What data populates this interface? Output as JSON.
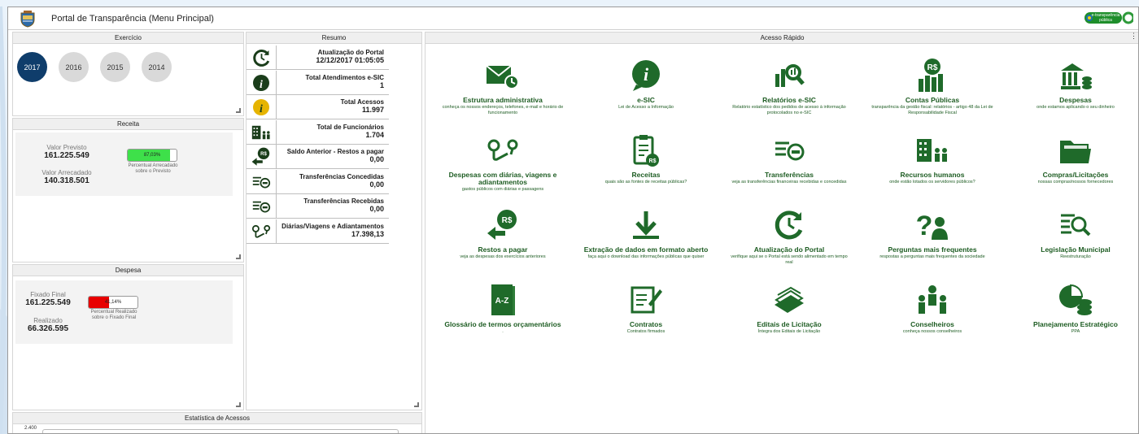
{
  "app": {
    "title": "Portal de Transparência (Menu Principal)",
    "badge_text": "e-transparência pública"
  },
  "exercicio": {
    "title": "Exercício",
    "years": [
      "2017",
      "2016",
      "2015",
      "2014"
    ],
    "selected": "2017"
  },
  "receita": {
    "title": "Receita",
    "previsto_label": "Valor Previsto",
    "previsto": "161.225.549",
    "arrecadado_label": "Valor Arrecadado",
    "arrecadado": "140.318.501",
    "percent_text": "87,03%",
    "percent_value": 87.03,
    "caption": "Percentual Arrecadado sobre o Previsto",
    "bar_color": "#3ee04a"
  },
  "despesa": {
    "title": "Despesa",
    "fixado_label": "Fixado Final",
    "fixado": "161.225.549",
    "realizado_label": "Realizado",
    "realizado": "66.326.595",
    "percent_text": "41,14%",
    "percent_value": 41.14,
    "caption": "Percentual Realizado sobre o Fixado Final",
    "bar_color": "#e80000"
  },
  "estatistica": {
    "title": "Estatística de Acessos",
    "y_tick": "2.400"
  },
  "resumo": {
    "title": "Resumo",
    "rows": [
      {
        "label": "Atualização do Portal",
        "value": "12/12/2017 01:05:05",
        "icon": "refresh-clock-icon"
      },
      {
        "label": "Total Atendimentos e-SIC",
        "value": "1",
        "icon": "info-icon"
      },
      {
        "label": "Total Acessos",
        "value": "11.997",
        "icon": "info-yellow-icon"
      },
      {
        "label": "Total de Funcionários",
        "value": "1.704",
        "icon": "building-people-icon"
      },
      {
        "label": "Saldo Anterior - Restos a pagar",
        "value": "0,00",
        "icon": "money-arrow-icon"
      },
      {
        "label": "Transferências Concedidas",
        "value": "0,00",
        "icon": "transfer-icon"
      },
      {
        "label": "Transferências Recebidas",
        "value": "0,00",
        "icon": "transfer-icon"
      },
      {
        "label": "Diárias/Viagens e Adiantamentos",
        "value": "17.398,13",
        "icon": "route-icon"
      }
    ]
  },
  "acesso": {
    "title": "Acesso Rápido",
    "tiles": [
      {
        "title": "Estrutura administrativa",
        "sub": "conheça os nossos endereços, telefones, e-mail e horário de funcionamento",
        "icon": "envelope-clock-icon"
      },
      {
        "title": "e-SIC",
        "sub": "Lei de Acesso a Informação",
        "icon": "info-bubble-icon"
      },
      {
        "title": "Relatórios e-SIC",
        "sub": "Relatório estatístico dos pedidos de acesso à informação protocolados no e-SIC",
        "icon": "chart-search-icon"
      },
      {
        "title": "Contas Públicas",
        "sub": "transparência da gestão fiscal: relatórios - artigo 48 da Lei de Responsabilidade Fiscal",
        "icon": "money-bars-icon"
      },
      {
        "title": "Despesas",
        "sub": "onde estamos aplicando o seu dinheiro",
        "icon": "bank-coins-icon"
      },
      {
        "title": "Despesas com diárias, viagens e adiantamentos",
        "sub": "gastos públicos com diárias e passagens",
        "icon": "route-icon"
      },
      {
        "title": "Receitas",
        "sub": "quais são as fontes de receitas públicas?",
        "icon": "clipboard-money-icon"
      },
      {
        "title": "Transferências",
        "sub": "veja as transferências financeiras recebidas e concedidas",
        "icon": "transfer-icon"
      },
      {
        "title": "Recursos humanos",
        "sub": "onde estão lotados os servidores públicos?",
        "icon": "building-people-icon"
      },
      {
        "title": "Compras/Licitações",
        "sub": "nossas compras/nossos fornecedores",
        "icon": "folder-icon"
      },
      {
        "title": "Restos a pagar",
        "sub": "veja as despesas dos exercícios anteriores",
        "icon": "money-arrow-icon"
      },
      {
        "title": "Extração de dados em formato aberto",
        "sub": "faça aqui o download das informações públicas que quiser",
        "icon": "download-icon"
      },
      {
        "title": "Atualização do Portal",
        "sub": "verifique aqui se o Portal está sendo alimentado em tempo real",
        "icon": "refresh-clock-icon"
      },
      {
        "title": "Perguntas mais frequentes",
        "sub": "respostas a perguntas mais frequentes da sociedade",
        "icon": "question-person-icon"
      },
      {
        "title": "Legislação Municipal",
        "sub": "Reestruturação",
        "icon": "list-search-icon"
      },
      {
        "title": "Glossário de termos orçamentários",
        "sub": ".",
        "icon": "book-az-icon"
      },
      {
        "title": "Contratos",
        "sub": "Contratos firmados",
        "icon": "contract-pen-icon"
      },
      {
        "title": "Editais de Licitação",
        "sub": "Íntegra dos Editais de Licitação",
        "icon": "papers-stack-icon"
      },
      {
        "title": "Conselheiros",
        "sub": "conheça nossos conselheiros",
        "icon": "people-group-icon"
      },
      {
        "title": "Planejamento Estratégico",
        "sub": "PPA",
        "icon": "pie-database-icon"
      }
    ]
  }
}
